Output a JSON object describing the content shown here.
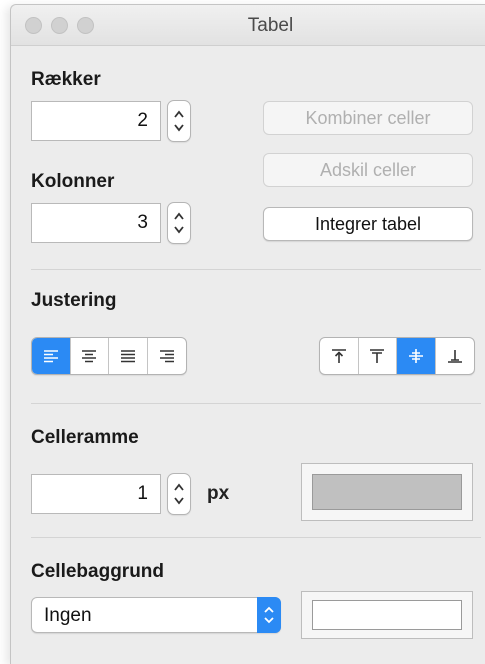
{
  "window": {
    "title": "Tabel"
  },
  "rows": {
    "label": "Rækker",
    "value": "2"
  },
  "columns": {
    "label": "Kolonner",
    "value": "3"
  },
  "buttons": {
    "merge": "Kombiner celler",
    "split": "Adskil celler",
    "integrate": "Integrer tabel"
  },
  "alignment": {
    "label": "Justering",
    "horizontal": [
      {
        "name": "align-left-icon",
        "selected": true
      },
      {
        "name": "align-center-icon",
        "selected": false
      },
      {
        "name": "align-justify-icon",
        "selected": false
      },
      {
        "name": "align-right-icon",
        "selected": false
      }
    ],
    "vertical": [
      {
        "name": "valign-top-icon",
        "selected": false
      },
      {
        "name": "valign-top-padded-icon",
        "selected": false
      },
      {
        "name": "valign-middle-icon",
        "selected": true
      },
      {
        "name": "valign-bottom-icon",
        "selected": false
      }
    ]
  },
  "border": {
    "label": "Celleramme",
    "value": "1",
    "unit": "px",
    "color": "#c0c0c0"
  },
  "background": {
    "label": "Cellebaggrund",
    "selected": "Ingen",
    "color": "#ffffff"
  },
  "colors": {
    "accent": "#2b8af4"
  }
}
